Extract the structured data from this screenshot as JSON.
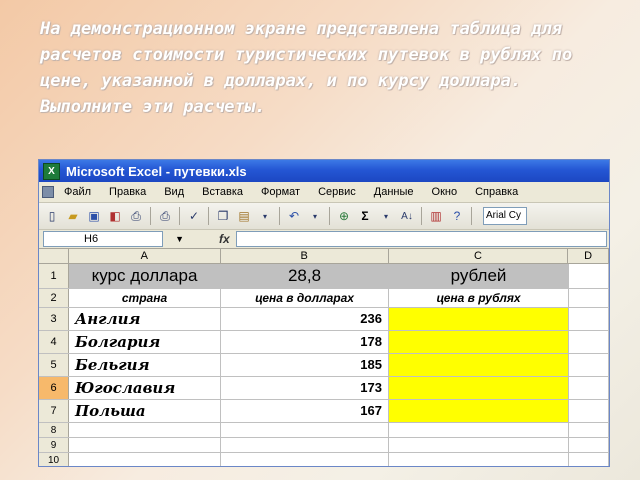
{
  "task_text": "На демонстрационном экране представлена таблица для расчетов стоимости туристических путевок в рублях по цене, указанной в долларах, и по курсу доллара. Выполните эти расчеты.",
  "window": {
    "title": "Microsoft Excel - путевки.xls",
    "app_icon": "excel-icon"
  },
  "menu": [
    "Файл",
    "Правка",
    "Вид",
    "Вставка",
    "Формат",
    "Сервис",
    "Данные",
    "Окно",
    "Справка"
  ],
  "toolbar": {
    "icons": [
      "new-icon",
      "open-icon",
      "save-icon",
      "permission-icon",
      "print-preview-icon",
      "print-icon",
      "spellcheck-icon",
      "copy-icon",
      "paste-icon",
      "undo-icon",
      "hyperlink-icon",
      "autosum-icon",
      "sort-ascending-icon",
      "chart-wizard-icon",
      "help-icon"
    ],
    "font_name": "Arial Cy"
  },
  "formula_bar": {
    "name_box": "H6",
    "fx": "fx",
    "formula": ""
  },
  "columns": [
    "A",
    "B",
    "C",
    "D"
  ],
  "rows": [
    {
      "num": "1",
      "a": "курс доллара",
      "b": "28,8",
      "c": "рублей"
    },
    {
      "num": "2",
      "a": "страна",
      "b": "цена в долларах",
      "c": "цена в рублях"
    },
    {
      "num": "3",
      "a": "Англия",
      "b": "236",
      "c": ""
    },
    {
      "num": "4",
      "a": "Болгария",
      "b": "178",
      "c": ""
    },
    {
      "num": "5",
      "a": "Бельгия",
      "b": "185",
      "c": ""
    },
    {
      "num": "6",
      "a": "Югославия",
      "b": "173",
      "c": ""
    },
    {
      "num": "7",
      "a": "Польша",
      "b": "167",
      "c": ""
    },
    {
      "num": "8",
      "a": "",
      "b": "",
      "c": ""
    },
    {
      "num": "9",
      "a": "",
      "b": "",
      "c": ""
    },
    {
      "num": "10",
      "a": "",
      "b": "",
      "c": ""
    }
  ],
  "colors": {
    "result_fill": "#ffff00",
    "header_fill": "#c0c0c0",
    "selected_row_header": "#f7b96b",
    "titlebar": "#2456d4"
  }
}
